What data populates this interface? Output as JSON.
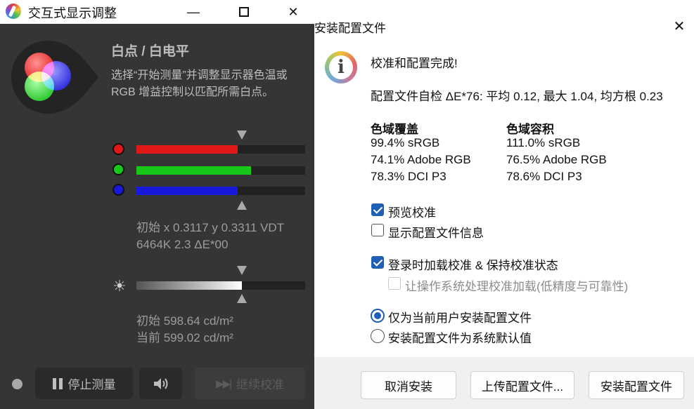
{
  "left_window": {
    "title": "交互式显示调整",
    "heading": "白点 / 白电平",
    "description": "选择“开始测量”并调整显示器色温或\nRGB 增益控制以匹配所需白点。",
    "channels": [
      {
        "name": "red",
        "color": "#e01818",
        "level": 0.6
      },
      {
        "name": "green",
        "color": "#18c818",
        "level": 0.68
      },
      {
        "name": "blue",
        "color": "#1818d8",
        "level": 0.6
      }
    ],
    "whitepoint_readout": [
      "初始 x 0.3117 y 0.3311 VDT",
      "6464K 2.3 ΔE*00"
    ],
    "luminance_level": 0.625,
    "luminance_readout": [
      "初始 598.64 cd/m²",
      "当前 599.02 cd/m²"
    ],
    "buttons": {
      "stop": "停止测量",
      "continue": "继续校准"
    }
  },
  "dialog": {
    "title": "安装配置文件",
    "message": "校准和配置完成!",
    "selfcheck": "配置文件自检 ΔE*76: 平均 0.12, 最大 1.04, 均方根 0.23",
    "gamut_coverage": {
      "header": "色域覆盖",
      "rows": [
        "99.4% sRGB",
        "74.1% Adobe RGB",
        "78.3% DCI P3"
      ]
    },
    "gamut_volume": {
      "header": "色域容积",
      "rows": [
        "111.0% sRGB",
        "76.5% Adobe RGB",
        "78.6% DCI P3"
      ]
    },
    "options": {
      "preview": {
        "label": "预览校准",
        "checked": true
      },
      "show_info": {
        "label": "显示配置文件信息",
        "checked": false
      },
      "load_on_login": {
        "label": "登录时加载校准 & 保持校准状态",
        "checked": true
      },
      "os_load": {
        "label": "让操作系统处理校准加载(低精度与可靠性)",
        "checked": false,
        "disabled": true
      }
    },
    "install_scope": {
      "current_user": {
        "label": "仅为当前用户安装配置文件",
        "selected": true
      },
      "system_default": {
        "label": "安装配置文件为系统默认值",
        "selected": false
      }
    },
    "buttons": {
      "cancel": "取消安装",
      "upload": "上传配置文件...",
      "install": "安装配置文件"
    }
  }
}
